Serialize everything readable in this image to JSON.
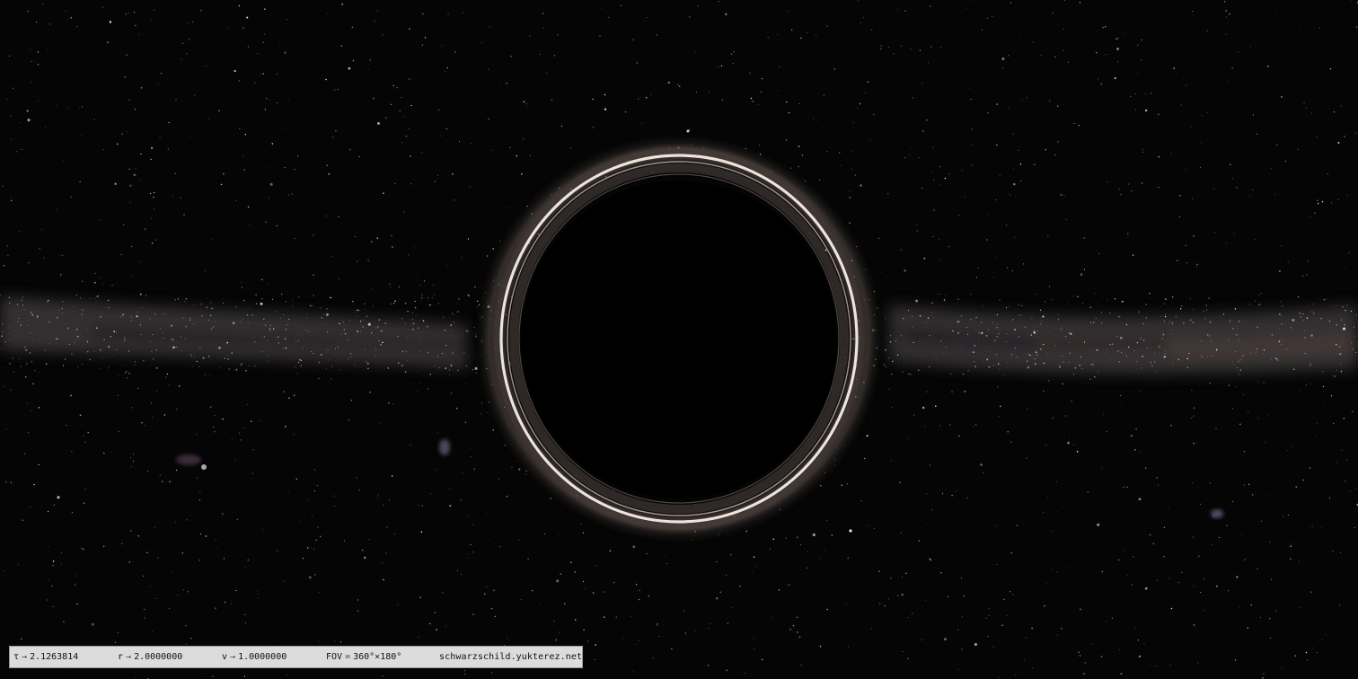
{
  "app": {
    "hud": {
      "tau": {
        "symbol": "τ",
        "arrow": "→",
        "value": "2.1263814"
      },
      "r": {
        "symbol": "r",
        "arrow": "→",
        "value": "2.0000000"
      },
      "v": {
        "symbol": "v",
        "arrow": "→",
        "value": "1.0000000"
      },
      "fov": {
        "label": "FOV",
        "equals": "=",
        "value": "360°×180°"
      },
      "site": "schwarzschild.yukterez.net"
    }
  },
  "colors": {
    "sky": "#050505",
    "horizon": "#000000",
    "ring": "#e8dcd4",
    "hud_background": "#dcdcdc",
    "hud_text": "#111111"
  }
}
